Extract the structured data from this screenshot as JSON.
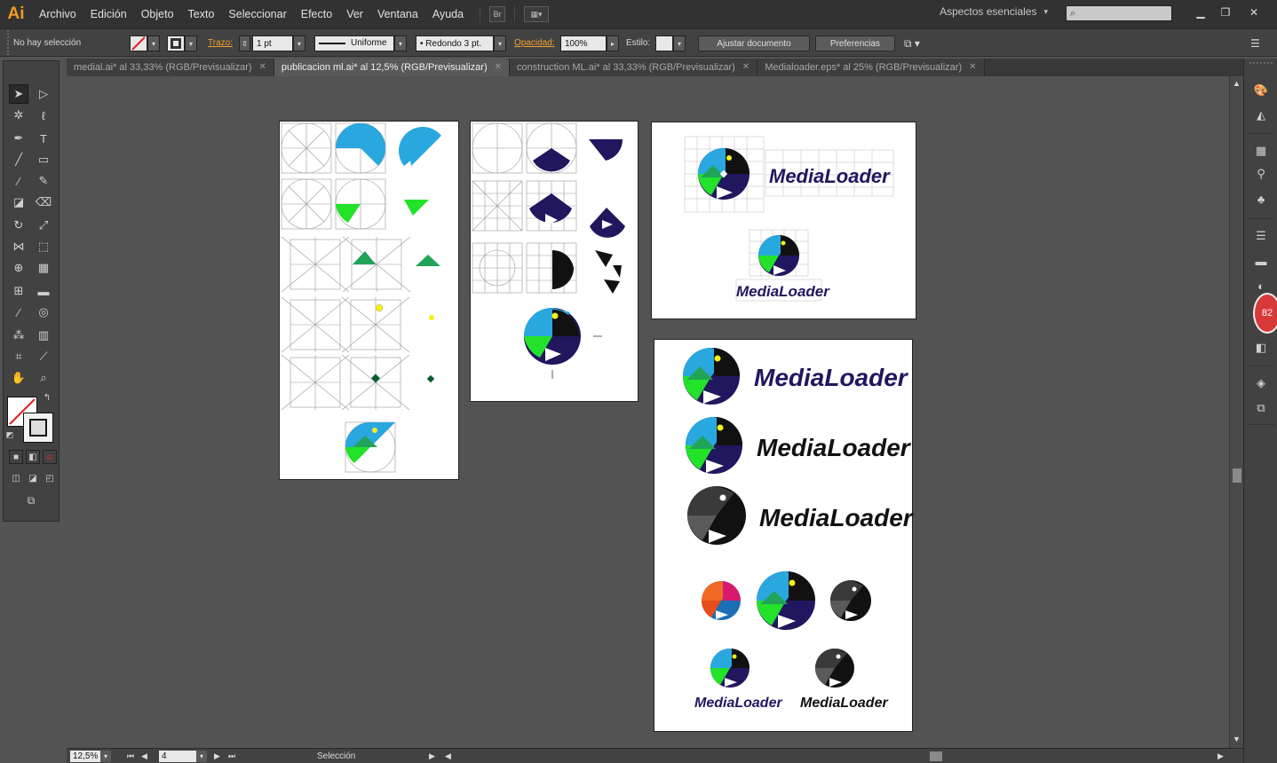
{
  "app": {
    "logo": "Ai"
  },
  "menu": [
    "Archivo",
    "Edición",
    "Objeto",
    "Texto",
    "Seleccionar",
    "Efecto",
    "Ver",
    "Ventana",
    "Ayuda"
  ],
  "menubar": {
    "bridge": "Br",
    "workspace": "Aspectos esenciales"
  },
  "controlbar": {
    "selection": "No hay selección",
    "stroke_label": "Trazo:",
    "stroke_weight": "1 pt",
    "stroke_profile": "Uniforme",
    "brush": "Redondo 3 pt.",
    "opacity_label": "Opacidad:",
    "opacity_value": "100%",
    "style_label": "Estilo:",
    "adjust_document": "Ajustar documento",
    "preferences": "Preferencias"
  },
  "tabs": [
    {
      "label": "medial.ai* al 33,33% (RGB/Previsualizar)",
      "active": false
    },
    {
      "label": "publicacion ml.ai* al 12,5% (RGB/Previsualizar)",
      "active": true
    },
    {
      "label": "construction ML.ai* al 33,33% (RGB/Previsualizar)",
      "active": false
    },
    {
      "label": "Medialoader.eps* al 25% (RGB/Previsualizar)",
      "active": false
    }
  ],
  "tab_close": "✕",
  "artwork": {
    "wordmark": "MediaLoader",
    "colors": {
      "sky": "#29a8e0",
      "green": "#22e22a",
      "navy": "#20175e",
      "teal": "#22a35a",
      "yellow": "#f5f01a",
      "black": "#111111"
    }
  },
  "status": {
    "zoom": "12,5%",
    "artboard": "4",
    "tool": "Selección"
  },
  "notification_count": "82"
}
